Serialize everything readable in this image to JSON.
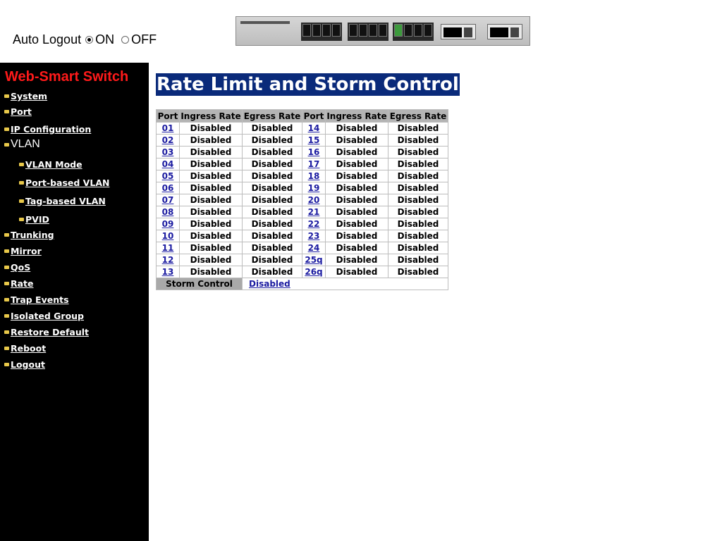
{
  "header": {
    "auto_logout_label": "Auto Logout",
    "option_on": "ON",
    "option_off": "OFF",
    "selected": "ON"
  },
  "sidebar": {
    "brand": "Web-Smart Switch",
    "brand_color": "#ff1a1a",
    "items": [
      {
        "label": "System",
        "level": 0
      },
      {
        "label": "Port",
        "level": 0
      },
      {
        "label": "IP Configuration",
        "level": 0
      },
      {
        "label": "VLAN",
        "level": 0
      },
      {
        "label": "VLAN Mode",
        "level": 1
      },
      {
        "label": "Port-based VLAN",
        "level": 1
      },
      {
        "label": "Tag-based VLAN",
        "level": 1
      },
      {
        "label": "PVID",
        "level": 1
      },
      {
        "label": "Trunking",
        "level": 0
      },
      {
        "label": "Mirror",
        "level": 0
      },
      {
        "label": "QoS",
        "level": 0
      },
      {
        "label": "Rate",
        "level": 0
      },
      {
        "label": "Trap Events",
        "level": 0
      },
      {
        "label": "Isolated Group",
        "level": 0
      },
      {
        "label": "Restore Default",
        "level": 0
      },
      {
        "label": "Reboot",
        "level": 0
      },
      {
        "label": "Logout",
        "level": 0
      }
    ]
  },
  "main": {
    "title": "Rate Limit and Storm Control",
    "title_bg": "#0a2a7a",
    "table": {
      "headers": [
        "Port",
        "Ingress Rate",
        "Egress Rate",
        "Port",
        "Ingress Rate",
        "Egress Rate"
      ],
      "rows": [
        {
          "left": {
            "port": "01",
            "ingress": "Disabled",
            "egress": "Disabled"
          },
          "right": {
            "port": "14",
            "ingress": "Disabled",
            "egress": "Disabled"
          }
        },
        {
          "left": {
            "port": "02",
            "ingress": "Disabled",
            "egress": "Disabled"
          },
          "right": {
            "port": "15",
            "ingress": "Disabled",
            "egress": "Disabled"
          }
        },
        {
          "left": {
            "port": "03",
            "ingress": "Disabled",
            "egress": "Disabled"
          },
          "right": {
            "port": "16",
            "ingress": "Disabled",
            "egress": "Disabled"
          }
        },
        {
          "left": {
            "port": "04",
            "ingress": "Disabled",
            "egress": "Disabled"
          },
          "right": {
            "port": "17",
            "ingress": "Disabled",
            "egress": "Disabled"
          }
        },
        {
          "left": {
            "port": "05",
            "ingress": "Disabled",
            "egress": "Disabled"
          },
          "right": {
            "port": "18",
            "ingress": "Disabled",
            "egress": "Disabled"
          }
        },
        {
          "left": {
            "port": "06",
            "ingress": "Disabled",
            "egress": "Disabled"
          },
          "right": {
            "port": "19",
            "ingress": "Disabled",
            "egress": "Disabled"
          }
        },
        {
          "left": {
            "port": "07",
            "ingress": "Disabled",
            "egress": "Disabled"
          },
          "right": {
            "port": "20",
            "ingress": "Disabled",
            "egress": "Disabled"
          }
        },
        {
          "left": {
            "port": "08",
            "ingress": "Disabled",
            "egress": "Disabled"
          },
          "right": {
            "port": "21",
            "ingress": "Disabled",
            "egress": "Disabled"
          }
        },
        {
          "left": {
            "port": "09",
            "ingress": "Disabled",
            "egress": "Disabled"
          },
          "right": {
            "port": "22",
            "ingress": "Disabled",
            "egress": "Disabled"
          }
        },
        {
          "left": {
            "port": "10",
            "ingress": "Disabled",
            "egress": "Disabled"
          },
          "right": {
            "port": "23",
            "ingress": "Disabled",
            "egress": "Disabled"
          }
        },
        {
          "left": {
            "port": "11",
            "ingress": "Disabled",
            "egress": "Disabled"
          },
          "right": {
            "port": "24",
            "ingress": "Disabled",
            "egress": "Disabled"
          }
        },
        {
          "left": {
            "port": "12",
            "ingress": "Disabled",
            "egress": "Disabled"
          },
          "right": {
            "port": "25q",
            "ingress": "Disabled",
            "egress": "Disabled"
          }
        },
        {
          "left": {
            "port": "13",
            "ingress": "Disabled",
            "egress": "Disabled"
          },
          "right": {
            "port": "26q",
            "ingress": "Disabled",
            "egress": "Disabled"
          }
        }
      ],
      "storm_control_label": "Storm Control",
      "storm_control_value": "Disabled"
    }
  }
}
